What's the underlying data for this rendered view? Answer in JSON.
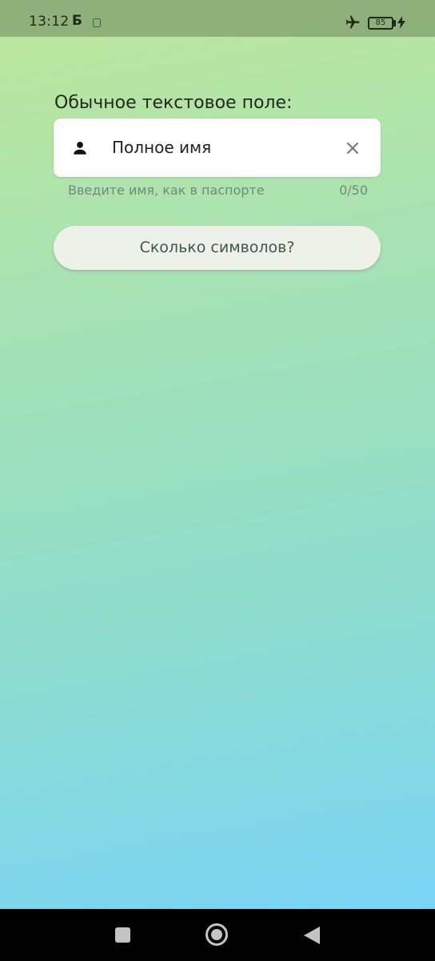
{
  "status_bar": {
    "time": "13:12",
    "carrier_icon": "Б",
    "battery": "85"
  },
  "form": {
    "caption": "Обычное текстовое поле:",
    "field_value": "Полное имя",
    "helper": "Введите имя, как в паспорте",
    "counter": "0/50",
    "button_label": "Сколько символов?"
  },
  "icons": {
    "person": "person-icon",
    "clear": "close-icon",
    "airplane": "airplane-icon",
    "battery": "battery-icon",
    "charging": "bolt-icon"
  },
  "nav_bar": {
    "recents": "square-icon",
    "home": "circle-icon",
    "back": "triangle-back-icon"
  },
  "colors": {
    "gradient_top": "#bde69a",
    "gradient_bottom": "#76d2fb",
    "status_bar": "#8fb07a",
    "field_background": "#ffffff",
    "button_background": "#eef0ea",
    "button_text": "#3a5a47",
    "helper_text": "#6f8a7a"
  }
}
